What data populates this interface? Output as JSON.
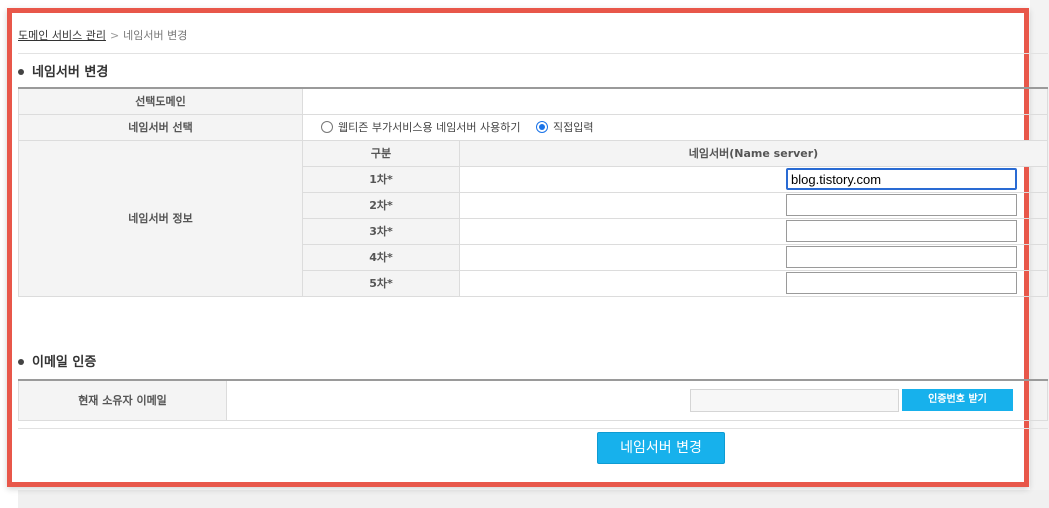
{
  "breadcrumb": {
    "parent": "도메인 서비스 관리",
    "separator": ">",
    "current": "네임서버 변경"
  },
  "section1": {
    "title": "네임서버 변경"
  },
  "rows": {
    "domain_label": "선택도메인",
    "select_label": "네임서버 선택",
    "info_label": "네임서버 정보"
  },
  "radio_options": [
    {
      "label": "웹티즌 부가서비스용 네임서버 사용하기",
      "checked": false
    },
    {
      "label": "직접입력",
      "checked": true
    }
  ],
  "ns_table": {
    "col_header": "구분",
    "ns_header": "네임서버(Name server)",
    "entries": [
      {
        "label": "1차*",
        "value": "blog.tistory.com"
      },
      {
        "label": "2차*",
        "value": ""
      },
      {
        "label": "3차*",
        "value": ""
      },
      {
        "label": "4차*",
        "value": ""
      },
      {
        "label": "5차*",
        "value": ""
      }
    ]
  },
  "section2": {
    "title": "이메일 인증"
  },
  "email": {
    "label": "현재 소유자 이메일",
    "value": "",
    "auth_button": "인증번호 받기"
  },
  "submit_button": "네임서버 변경"
}
